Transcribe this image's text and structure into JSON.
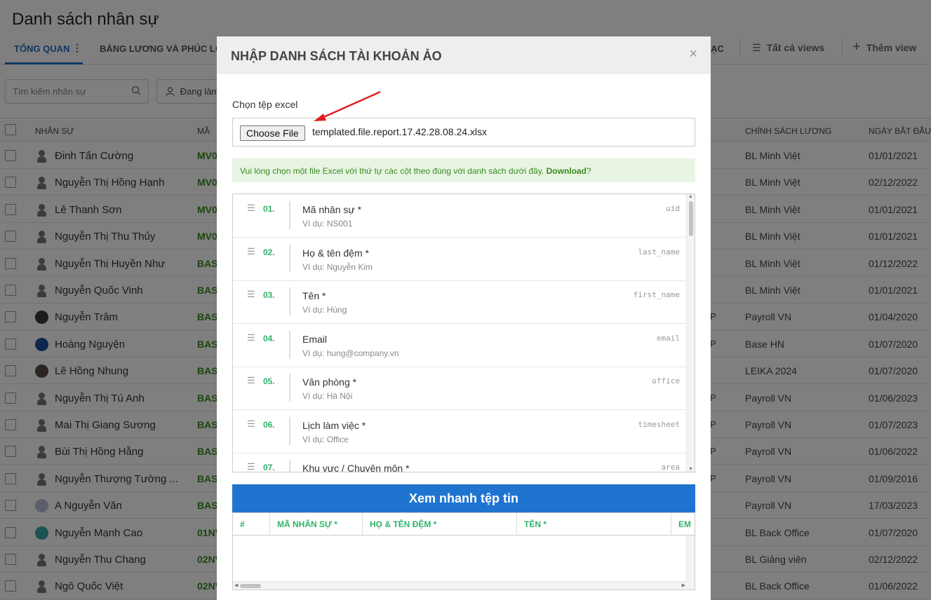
{
  "page": {
    "title": "Danh sách nhân sự",
    "tabs": [
      {
        "label": "Tổng quan",
        "active": true
      },
      {
        "label": "Bảng lương và phúc lợi",
        "active": false
      },
      {
        "label": "ạc",
        "active": false
      }
    ],
    "tab_menu_icon": "vertical-dots-icon",
    "views": [
      {
        "icon": "list-icon",
        "glyph": "☰",
        "label": "Tất cả views"
      },
      {
        "icon": "plus-icon",
        "glyph": "+",
        "label": "Thêm view"
      }
    ],
    "search": {
      "placeholder": "Tìm kiếm nhân sự",
      "icon": "search-icon"
    },
    "filter": {
      "label": "Đang làm",
      "icon": "user-icon"
    },
    "table": {
      "headers": {
        "name": "Nhân sự",
        "code": "Mã",
        "policy": "Chính sách lương",
        "start_date": "Ngày bắt đầu"
      },
      "rows": [
        {
          "name": "Đinh Tấn Cường",
          "code": "MV0",
          "policy": "BL Minh Việt",
          "date": "01/01/2021",
          "avatar": "silhouette",
          "mark": ""
        },
        {
          "name": "Nguyễn Thị Hồng Hạnh",
          "code": "MV0",
          "policy": "BL Minh Việt",
          "date": "02/12/2022",
          "avatar": "silhouette",
          "mark": ""
        },
        {
          "name": "Lê Thanh Sơn",
          "code": "MV0",
          "policy": "BL Minh Việt",
          "date": "01/01/2021",
          "avatar": "silhouette",
          "mark": ""
        },
        {
          "name": "Nguyễn Thị Thu Thủy",
          "code": "MV0",
          "policy": "BL Minh Việt",
          "date": "01/01/2021",
          "avatar": "silhouette",
          "mark": ""
        },
        {
          "name": "Nguyễn Thị Huyền Như",
          "code": "BAS",
          "policy": "BL Minh Việt",
          "date": "01/12/2022",
          "avatar": "silhouette",
          "mark": ""
        },
        {
          "name": "Nguyễn Quốc Vinh",
          "code": "BAS",
          "policy": "BL Minh Việt",
          "date": "01/01/2021",
          "avatar": "silhouette",
          "mark": ""
        },
        {
          "name": "Nguyễn Trâm",
          "code": "BAS",
          "policy": "Payroll VN",
          "date": "01/04/2020",
          "avatar": "#3a3a3a",
          "mark": "P"
        },
        {
          "name": "Hoàng Nguyện",
          "code": "BAS",
          "policy": "Base HN",
          "date": "01/07/2020",
          "avatar": "#1d4fa3",
          "mark": "P"
        },
        {
          "name": "Lê Hồng Nhung",
          "code": "BAS",
          "policy": "LEIKA 2024",
          "date": "01/07/2020",
          "avatar": "#5a4a44",
          "mark": ""
        },
        {
          "name": "Nguyễn Thị Tú Anh",
          "code": "BAS",
          "policy": "Payroll VN",
          "date": "01/06/2023",
          "avatar": "silhouette",
          "mark": "P"
        },
        {
          "name": "Mai Thị Giang Sương",
          "code": "BAS",
          "policy": "Payroll VN",
          "date": "01/07/2023",
          "avatar": "silhouette",
          "mark": "P"
        },
        {
          "name": "Bùi Thị Hồng Hằng",
          "code": "BAS",
          "policy": "Payroll VN",
          "date": "01/06/2022",
          "avatar": "silhouette",
          "mark": "P"
        },
        {
          "name": "Nguyễn Thượng Tường ...",
          "code": "BAS",
          "policy": "Payroll VN",
          "date": "01/09/2016",
          "avatar": "silhouette",
          "mark": "P"
        },
        {
          "name": "A Nguyễn Văn",
          "code": "BAS",
          "policy": "Payroll VN",
          "date": "17/03/2023",
          "avatar": "#b9bfd6",
          "mark": ""
        },
        {
          "name": "Nguyễn Mạnh Cao",
          "code": "01NV",
          "policy": "BL Back Office",
          "date": "01/07/2020",
          "avatar": "#3aa3a8",
          "mark": ""
        },
        {
          "name": "Nguyễn Thu Chang",
          "code": "02NV",
          "policy": "BL Giảng viên",
          "date": "02/12/2022",
          "avatar": "silhouette",
          "mark": ""
        },
        {
          "name": "Ngô Quốc Việt",
          "code": "02NV",
          "policy": "BL Back Office",
          "date": "01/06/2022",
          "avatar": "silhouette",
          "mark": ""
        }
      ]
    }
  },
  "modal": {
    "title": "NHẬP DANH SÁCH TÀI KHOẢN ẢO",
    "close_icon": "×",
    "file_label": "Chọn tệp excel",
    "file_button": "Choose File",
    "file_name": "templated.file.report.17.42.28.08.24.xlsx",
    "hint_text": "Vui lòng chọn một file Excel với thứ tự các cột theo đúng với danh sách dưới đây.",
    "hint_link": "Download",
    "hint_suffix": "?",
    "columns": [
      {
        "num": "01.",
        "label": "Mã nhân sự *",
        "example": "Ví dụ: NS001",
        "key": "uid"
      },
      {
        "num": "02.",
        "label": "Họ & tên đệm *",
        "example": "Ví dụ: Nguyễn Kim",
        "key": "last_name"
      },
      {
        "num": "03.",
        "label": "Tên *",
        "example": "Ví dụ: Hùng",
        "key": "first_name"
      },
      {
        "num": "04.",
        "label": "Email",
        "example": "Ví dụ: hung@company.vn",
        "key": "email"
      },
      {
        "num": "05.",
        "label": "Văn phòng *",
        "example": "Ví dụ: Hà Nội",
        "key": "office"
      },
      {
        "num": "06.",
        "label": "Lịch làm việc *",
        "example": "Ví dụ: Office",
        "key": "timesheet"
      },
      {
        "num": "07.",
        "label": "Khu vực / Chuyên môn *",
        "example": "",
        "key": "area"
      }
    ],
    "preview": {
      "title": "Xem nhanh tệp tin",
      "headers": [
        "#",
        "MÃ NHÂN SỰ *",
        "HỌ & TÊN ĐỆM *",
        "TÊN *",
        "EM"
      ]
    }
  },
  "colors": {
    "accent_blue": "#1f74d0",
    "green": "#2fb36b",
    "hint_bg": "#e8f5e3",
    "arrow": "#e02020"
  }
}
